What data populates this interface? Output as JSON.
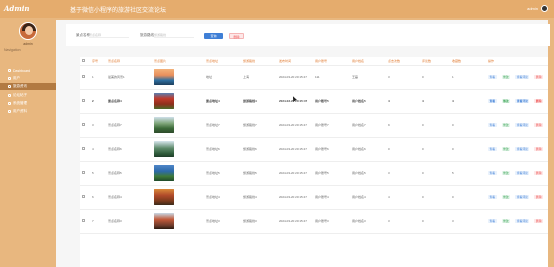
{
  "header": {
    "logo": "Admin",
    "title": "基于微信小程序的旅游社区交流论坛",
    "admin_name": "admin"
  },
  "sidebar": {
    "admin_label": "admin",
    "heading": "Navigation",
    "items": [
      {
        "label": "Dashboard",
        "active": false
      },
      {
        "label": "用户",
        "active": false
      },
      {
        "label": "旅游资讯",
        "active": true
      },
      {
        "label": "论坛帖子",
        "active": false
      },
      {
        "label": "系统管理",
        "active": false
      },
      {
        "label": "用户资料",
        "active": false
      }
    ]
  },
  "search": {
    "field1_label": "景点名称",
    "field1_placeholder": "景点名称",
    "field2_label": "旅游路线",
    "field2_placeholder": "旅游路线",
    "query_button": "查询",
    "delete_button": "删除"
  },
  "table": {
    "columns": [
      "序号",
      "景点名称",
      "景点图片",
      "景点地址",
      "旅游路线",
      "发布时间",
      "用户账号",
      "用户姓名",
      "点击次数",
      "评论数",
      "收藏数",
      "操作"
    ],
    "rows": [
      {
        "index": "1",
        "name": "最美的风景1",
        "address": "地址",
        "route": "上海",
        "time": "2024-03-20 20:15:47",
        "account": "111",
        "username": "王磊",
        "clicks": "3",
        "comments": "0",
        "favorites": "1"
      },
      {
        "index": "2",
        "name": "景点名称4",
        "address": "景点地址4",
        "route": "旅游路线4",
        "time": "2024-03-20 20:15:47",
        "account": "用户账号5",
        "username": "用户姓名5",
        "clicks": "4",
        "comments": "4",
        "favorites": "4"
      },
      {
        "index": "3",
        "name": "景点名称7",
        "address": "景点地址7",
        "route": "旅游路线7",
        "time": "2024-03-20 20:15:47",
        "account": "用户账号7",
        "username": "用户姓名7",
        "clicks": "9",
        "comments": "0",
        "favorites": "0"
      },
      {
        "index": "4",
        "name": "景点名称6",
        "address": "景点地址6",
        "route": "旅游路线6",
        "time": "2024-03-20 20:15:47",
        "account": "用户账号6",
        "username": "用户姓名6",
        "clicks": "0",
        "comments": "0",
        "favorites": "0"
      },
      {
        "index": "5",
        "name": "景点名称5",
        "address": "景点地址5",
        "route": "旅游路线5",
        "time": "2024-03-20 20:15:47",
        "account": "用户账号5",
        "username": "用户姓名5",
        "clicks": "3",
        "comments": "0",
        "favorites": "5"
      },
      {
        "index": "6",
        "name": "景点名称4",
        "address": "景点地址4",
        "route": "旅游路线4",
        "time": "2024-03-20 20:15:47",
        "account": "用户账号4",
        "username": "用户姓名4",
        "clicks": "4",
        "comments": "0",
        "favorites": "0"
      },
      {
        "index": "7",
        "name": "景点名称3",
        "address": "景点地址3",
        "route": "旅游路线3",
        "time": "2024-03-20 20:15:47",
        "account": "用户账号3",
        "username": "用户姓名3",
        "clicks": "3",
        "comments": "0",
        "favorites": "3"
      }
    ],
    "actions": {
      "view": "查看",
      "edit": "修改",
      "comment": "查看评论",
      "delete": "删除"
    }
  },
  "watermark": "CSDN @清风学姐",
  "colors": {
    "sidebar": "#e8b77f",
    "topbar": "#e5ac6d",
    "active_nav": "#b27a42",
    "primary": "#3f7fd6",
    "danger": "#e55555",
    "header_text": "#e07a30"
  },
  "icons": [
    "avatar",
    "checkbox-icon",
    "nav-icon",
    "cursor-icon"
  ]
}
